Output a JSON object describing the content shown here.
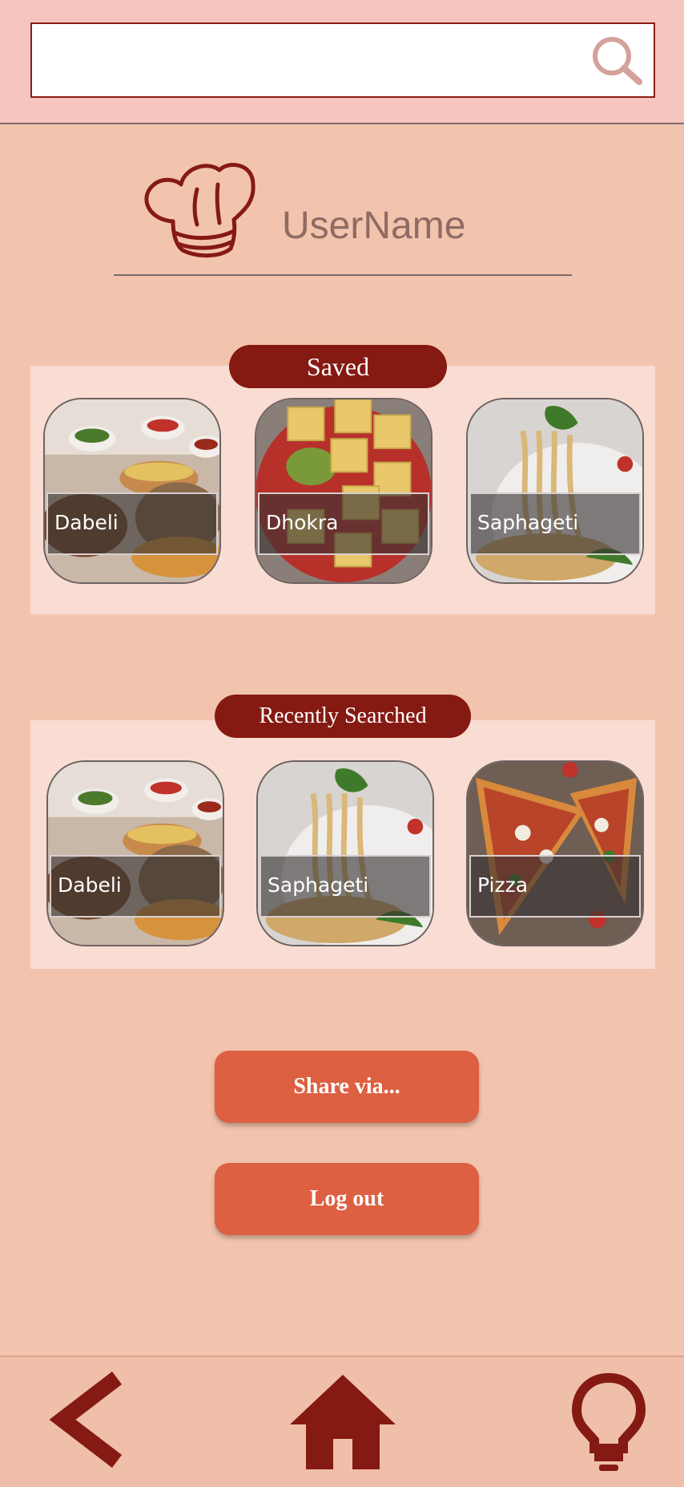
{
  "search": {
    "value": "",
    "placeholder": ""
  },
  "profile": {
    "username": "UserName"
  },
  "saved": {
    "title": "Saved",
    "items": [
      {
        "label": "Dabeli"
      },
      {
        "label": "Dhokra"
      },
      {
        "label": "Saphageti"
      }
    ]
  },
  "recent": {
    "title": "Recently Searched",
    "items": [
      {
        "label": "Dabeli"
      },
      {
        "label": "Saphageti"
      },
      {
        "label": "Pizza"
      }
    ]
  },
  "actions": {
    "share_label": "Share via...",
    "logout_label": "Log out"
  },
  "colors": {
    "accent": "#851a12",
    "button": "#dc6041",
    "background": "#f3c4ad",
    "header": "#f6c5c0"
  },
  "icons": {
    "search": "search-icon",
    "chef": "chef-hat-icon",
    "back": "back-arrow-icon",
    "home": "home-icon",
    "hint": "lightbulb-icon"
  }
}
